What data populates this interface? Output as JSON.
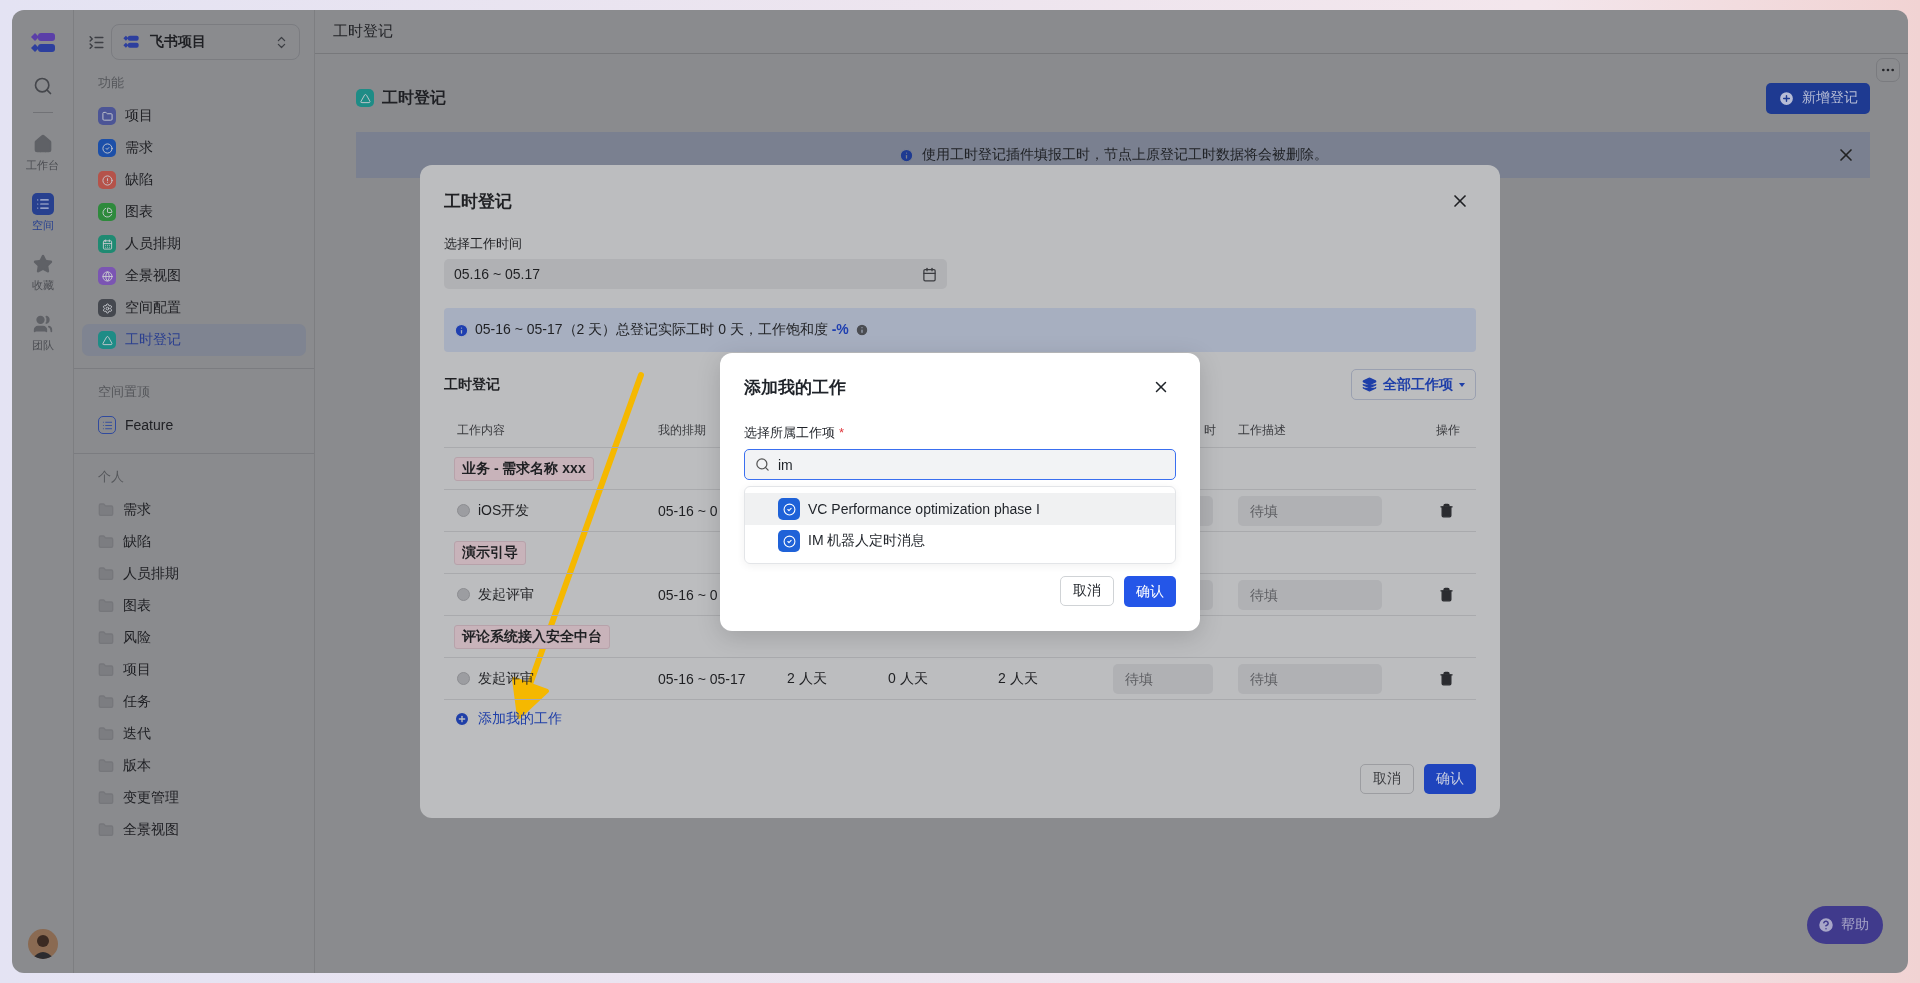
{
  "header": {
    "title": "工时登记"
  },
  "rail": {
    "items": [
      {
        "label": "工作台",
        "kind": "home",
        "selected": false
      },
      {
        "label": "空间",
        "kind": "space",
        "selected": true
      },
      {
        "label": "收藏",
        "kind": "star",
        "selected": false
      },
      {
        "label": "团队",
        "kind": "team",
        "selected": false
      }
    ]
  },
  "sidebar": {
    "space_name": "飞书项目",
    "sections": [
      {
        "title": "功能",
        "items": [
          {
            "label": "项目",
            "kind": "feature",
            "color": "#4c5596",
            "selected": false
          },
          {
            "label": "需求",
            "kind": "feature",
            "color": "#1c4fa8",
            "selected": false
          },
          {
            "label": "缺陷",
            "kind": "feature",
            "color": "#b5534a",
            "selected": false
          },
          {
            "label": "图表",
            "kind": "feature",
            "color": "#2e8a3c",
            "selected": false
          },
          {
            "label": "人员排期",
            "kind": "feature",
            "color": "#1f8a72",
            "selected": false
          },
          {
            "label": "全景视图",
            "kind": "feature",
            "color": "#7b55b3",
            "selected": false
          },
          {
            "label": "空间配置",
            "kind": "feature",
            "color": "#45484f",
            "selected": false
          },
          {
            "label": "工时登记",
            "kind": "feature",
            "color": "#1e8c86",
            "selected": true
          }
        ]
      },
      {
        "title": "空间置顶",
        "items": [
          {
            "label": "Feature",
            "kind": "pinned",
            "selected": false
          }
        ]
      },
      {
        "title": "个人",
        "items": [
          {
            "label": "需求",
            "kind": "folder",
            "selected": false
          },
          {
            "label": "缺陷",
            "kind": "folder",
            "selected": false
          },
          {
            "label": "人员排期",
            "kind": "folder",
            "selected": false
          },
          {
            "label": "图表",
            "kind": "folder",
            "selected": false
          },
          {
            "label": "风险",
            "kind": "folder",
            "selected": false
          },
          {
            "label": "项目",
            "kind": "folder",
            "selected": false
          },
          {
            "label": "任务",
            "kind": "folder",
            "selected": false
          },
          {
            "label": "迭代",
            "kind": "folder",
            "selected": false
          },
          {
            "label": "版本",
            "kind": "folder",
            "selected": false
          },
          {
            "label": "变更管理",
            "kind": "folder",
            "selected": false
          },
          {
            "label": "全景视图",
            "kind": "folder",
            "selected": false
          }
        ]
      }
    ]
  },
  "page": {
    "title": "工时登记",
    "new_button": "新增登记",
    "notice": "使用工时登记插件填报工时，节点上原登记工时数据将会被删除。",
    "help_button": "帮助"
  },
  "modal": {
    "title": "工时登记",
    "date_label": "选择工作时间",
    "date_value": "05.16 ~ 05.17",
    "summary": "05-16 ~ 05-17（2 天）总登记实际工时 0 天，工作饱和度 **-%**",
    "section_title": "工时登记",
    "filter_button": "全部工作项",
    "columns": {
      "content": "工作内容",
      "schedule": "我的排期",
      "column_6": "时",
      "description": "工作描述",
      "actions": "操作"
    },
    "groups": [
      {
        "tag": "业务 - 需求名称 xxx",
        "rows": [
          {
            "name": "iOS开发",
            "schedule": "05-16 ~ 0",
            "description_placeholder": "待填"
          }
        ]
      },
      {
        "tag": "演示引导",
        "rows": [
          {
            "name": "发起评审",
            "schedule": "05-16 ~ 0",
            "description_placeholder": "待填"
          }
        ]
      },
      {
        "tag": "评论系统接入安全中台",
        "rows": [
          {
            "name": "发起评审",
            "schedule": "05-16 ~ 05-17",
            "column_3": "2 人天",
            "column_4": "0 人天",
            "column_5": "2 人天",
            "column_6_placeholder": "待填",
            "description_placeholder": "待填"
          }
        ]
      }
    ],
    "add_link": "添加我的工作",
    "cancel": "取消",
    "confirm": "确认"
  },
  "dialog": {
    "title": "添加我的工作",
    "field_label": "选择所属工作项",
    "required_mark": "*",
    "search_value": "im",
    "options": [
      {
        "label": "VC Performance optimization phase I",
        "selected": true
      },
      {
        "label": "IM 机器人定时消息",
        "selected": false
      }
    ],
    "cancel": "取消",
    "confirm": "确认"
  }
}
